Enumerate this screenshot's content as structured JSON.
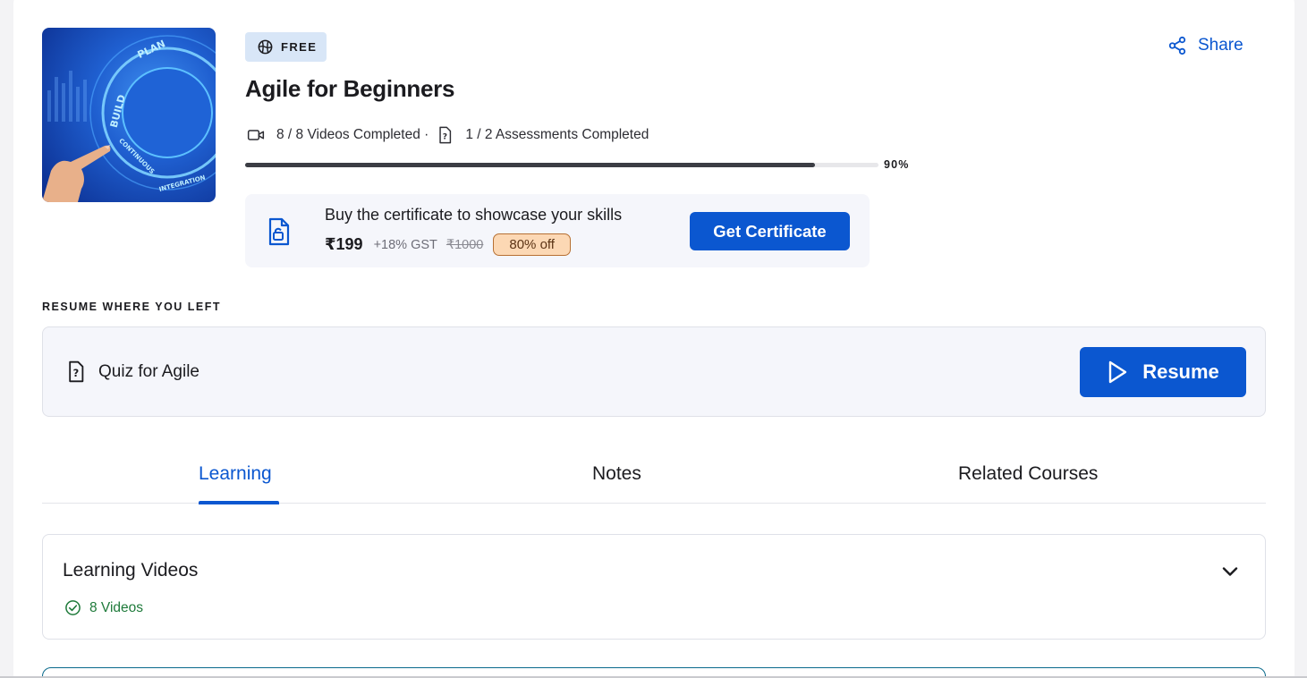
{
  "course": {
    "badge": "FREE",
    "title": "Agile for Beginners",
    "share_label": "Share",
    "videos_completed": "8 / 8 Videos Completed ·",
    "assessments_completed": "1 / 2 Assessments Completed",
    "progress_percent": 90,
    "progress_label": "90%",
    "thumbnail_labels": [
      "PLAN",
      "BUILD",
      "CONTINUOUS",
      "INTEGRATION"
    ]
  },
  "certificate": {
    "heading": "Buy the certificate to showcase your skills",
    "price": "₹199",
    "gst": "+18% GST",
    "original_price": "₹1000",
    "discount": "80% off",
    "button_label": "Get Certificate"
  },
  "resume": {
    "section_label": "RESUME WHERE YOU LEFT",
    "item_title": "Quiz for Agile",
    "button_label": "Resume"
  },
  "tabs": [
    {
      "label": "Learning",
      "active": true
    },
    {
      "label": "Notes",
      "active": false
    },
    {
      "label": "Related Courses",
      "active": false
    }
  ],
  "learning_videos": {
    "title": "Learning Videos",
    "count_label": "8 Videos"
  },
  "colors": {
    "accent": "#0b57d0",
    "success": "#1e7a3a",
    "discount_bg": "#fcd8b4"
  },
  "icons": [
    "badge-globe-icon",
    "share-icon",
    "video-icon",
    "assessment-icon",
    "certificate-lock-icon",
    "quiz-icon",
    "play-icon",
    "check-circle-icon",
    "chevron-down-icon"
  ]
}
